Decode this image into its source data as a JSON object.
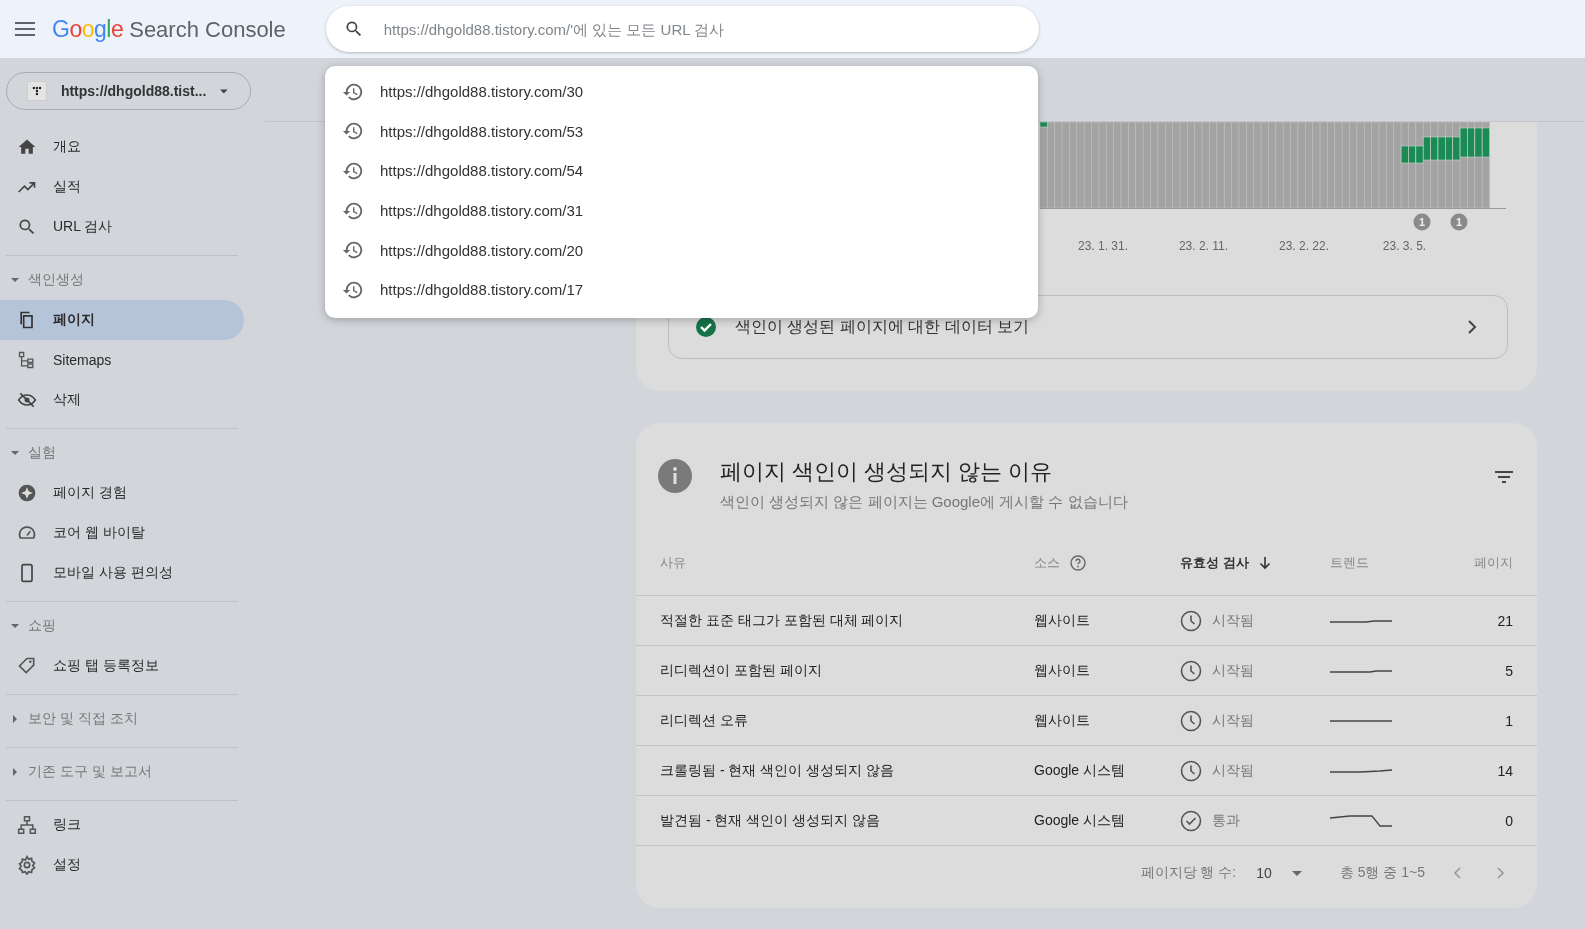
{
  "header": {
    "logo_brand": "Google",
    "logo_product": "Search Console",
    "search": {
      "placeholder": "https://dhgold88.tistory.com/'에 있는 모든 URL 검사"
    }
  },
  "search_history": [
    "https://dhgold88.tistory.com/30",
    "https://dhgold88.tistory.com/53",
    "https://dhgold88.tistory.com/54",
    "https://dhgold88.tistory.com/31",
    "https://dhgold88.tistory.com/20",
    "https://dhgold88.tistory.com/17"
  ],
  "property": {
    "label": "https://dhgold88.tist..."
  },
  "sidebar": [
    {
      "kind": "plain",
      "items": [
        {
          "label": "개요",
          "selected": false
        },
        {
          "label": "실적",
          "selected": false
        },
        {
          "label": "URL 검사",
          "selected": false
        }
      ]
    },
    {
      "kind": "section",
      "label": "색인생성",
      "expanded": true,
      "items": [
        {
          "label": "페이지",
          "selected": true
        },
        {
          "label": "Sitemaps",
          "selected": false
        },
        {
          "label": "삭제",
          "selected": false
        }
      ]
    },
    {
      "kind": "section",
      "label": "실험",
      "expanded": true,
      "items": [
        {
          "label": "페이지 경험",
          "selected": false
        },
        {
          "label": "코어 웹 바이탈",
          "selected": false
        },
        {
          "label": "모바일 사용 편의성",
          "selected": false
        }
      ]
    },
    {
      "kind": "section",
      "label": "쇼핑",
      "expanded": true,
      "items": [
        {
          "label": "쇼핑 탭 등록정보",
          "selected": false
        }
      ]
    },
    {
      "kind": "section",
      "label": "보안 및 직접 조치",
      "expanded": false
    },
    {
      "kind": "section",
      "label": "기존 도구 및 보고서",
      "expanded": false
    },
    {
      "kind": "plain",
      "items": [
        {
          "label": "링크",
          "selected": false
        },
        {
          "label": "설정",
          "selected": false
        }
      ]
    }
  ],
  "chart_card": {
    "x_labels": [
      "23. 1. 31.",
      "23. 2. 11.",
      "23. 2. 22.",
      "23. 3. 5."
    ],
    "markers": [
      "1",
      "1"
    ],
    "link": {
      "label": "색인이 생성된 페이지에 대한 데이터 보기"
    }
  },
  "reasons_card": {
    "title": "페이지 색인이 생성되지 않는 이유",
    "subtitle": "색인이 생성되지 않은 페이지는 Google에 게시할 수 없습니다",
    "columns": [
      {
        "label": "사유",
        "help": false,
        "sorted": false
      },
      {
        "label": "소스",
        "help": true,
        "sorted": false
      },
      {
        "label": "유효성 검사",
        "help": false,
        "sorted": true
      },
      {
        "label": "트렌드",
        "help": false,
        "sorted": false
      },
      {
        "label": "페이지",
        "help": false,
        "sorted": false
      }
    ],
    "rows": [
      {
        "reason": "적절한 표준 태그가 포함된 대체 페이지",
        "source": "웹사이트",
        "validation": {
          "kind": "started",
          "label": "시작됨"
        },
        "pages": "21"
      },
      {
        "reason": "리디렉션이 포함된 페이지",
        "source": "웹사이트",
        "validation": {
          "kind": "started",
          "label": "시작됨"
        },
        "pages": "5"
      },
      {
        "reason": "리디렉션 오류",
        "source": "웹사이트",
        "validation": {
          "kind": "started",
          "label": "시작됨"
        },
        "pages": "1"
      },
      {
        "reason": "크롤링됨 - 현재 색인이 생성되지 않음",
        "source": "Google 시스템",
        "validation": {
          "kind": "started",
          "label": "시작됨"
        },
        "pages": "14"
      },
      {
        "reason": "발견됨 - 현재 색인이 생성되지 않음",
        "source": "Google 시스템",
        "validation": {
          "kind": "passed",
          "label": "통과"
        },
        "pages": "0"
      }
    ],
    "footer": {
      "rows_per_page_label": "페이지당 행 수:",
      "rows_per_page": "10",
      "range": "총 5행 중 1~5"
    }
  }
}
